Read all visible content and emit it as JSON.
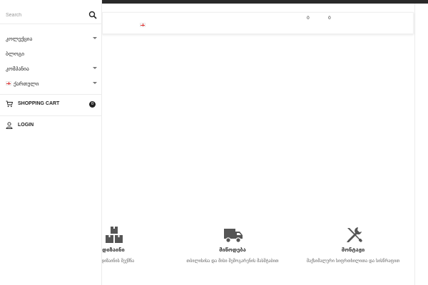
{
  "drawer": {
    "search": {
      "placeholder": "Search"
    },
    "menu": [
      {
        "label": "კოლექცია",
        "has_submenu": true
      },
      {
        "label": "ბლოგი",
        "has_submenu": false
      },
      {
        "label": "კომპანია",
        "has_submenu": true
      },
      {
        "label": "ქართული",
        "has_submenu": true,
        "icon": "georgia-flag-icon"
      }
    ],
    "cart": {
      "label": "SHOPPING CART",
      "count": "0"
    },
    "login": {
      "label": "LOGIN"
    }
  },
  "header": {
    "counter_left": "0",
    "counter_right": "0"
  },
  "features": [
    {
      "icon": "boxes-icon",
      "title": "დიზაინი",
      "desc": "ლი დიზაინის შექმნა"
    },
    {
      "icon": "truck-icon",
      "title": "მიწოდება",
      "desc": "თბილისისა და მისი შემოგარენის მასშტაბით"
    },
    {
      "icon": "tools-icon",
      "title": "მონტაჟი",
      "desc": "მაქსიმალური სიფრთხილითა და სისწრაფით"
    }
  ],
  "colors": {
    "topbar": "#2a2a2a",
    "badge": "#222222",
    "flag_cross": "#d9302f"
  }
}
